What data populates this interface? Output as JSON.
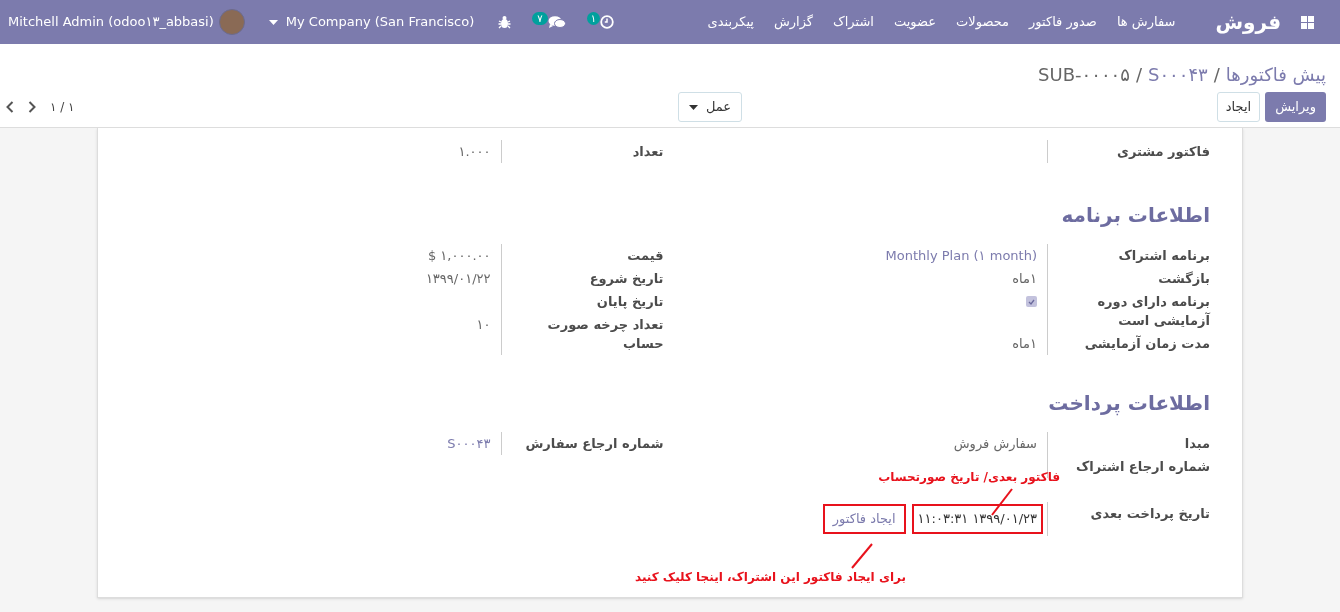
{
  "navbar": {
    "app_title": "فروش",
    "menu": [
      "سفارش ها",
      "صدور فاکتور",
      "محصولات",
      "عضویت",
      "اشتراک",
      "گزارش",
      "پیکربندی"
    ],
    "activity_count": "۱",
    "message_count": "۷",
    "company": "My Company (San Francisco)",
    "user": "Mitchell Admin (odoo۱۳_abbasi)"
  },
  "breadcrumb": [
    {
      "label": "پیش فاکتورها",
      "link": true
    },
    {
      "separator": "/",
      "label": "S۰۰۰۴۳",
      "link": true
    },
    {
      "separator": "/",
      "label": "SUB-۰۰۰۰۵",
      "link": false
    }
  ],
  "buttons": {
    "edit": "ویرایش",
    "create": "ایجاد",
    "action": "عمل"
  },
  "pager": "۱ / ۱",
  "sections": [
    {
      "right": [
        {
          "label": "فاکتور مشتری",
          "kind": "text"
        }
      ],
      "left": [
        {
          "label": "تعداد",
          "kind": "text",
          "value": "۱.۰۰۰"
        }
      ]
    },
    {
      "title": "اطلاعات برنامه",
      "right": [
        {
          "label": "برنامه اشتراک",
          "kind": "link",
          "value": "Monthly Plan (۱ month)"
        },
        {
          "label": "بازگشت",
          "kind": "text",
          "value": "۱ماه"
        },
        {
          "label": "برنامه دارای دوره آزمایشی است",
          "kind": "checkbox",
          "checked": true
        },
        {
          "label": "مدت زمان آزمایشی",
          "kind": "text",
          "value": "۱ماه"
        }
      ],
      "left": [
        {
          "label": "قیمت",
          "kind": "text",
          "value": "۱,۰۰۰.۰۰ $"
        },
        {
          "label": "تاریخ شروع",
          "kind": "text",
          "value": "۱۳۹۹/۰۱/۲۲"
        },
        {
          "label": "تاریخ پایان",
          "kind": "text"
        },
        {
          "label": "تعداد چرخه صورت حساب",
          "kind": "text",
          "value": "۱۰"
        }
      ]
    },
    {
      "title": "اطلاعات پرداخت",
      "right": [
        {
          "label": "مبدا",
          "kind": "text",
          "value": "سفارش فروش"
        },
        {
          "label": "شماره ارجاع اشتراک",
          "kind": "text"
        },
        {
          "label": "تاریخ پرداخت بعدی",
          "kind": "date_action",
          "value": "۱۳۹۹/۰۱/۲۳ ۱۱:۰۳:۳۱",
          "action": "ایجاد فاکتور",
          "highlighted": true
        }
      ],
      "left": [
        {
          "label": "شماره ارجاع سفارش",
          "kind": "link",
          "value": "S۰۰۰۴۳"
        }
      ]
    }
  ],
  "annotations": [
    {
      "text": "فاکتور بعدی/ تاریخ صورتحساب",
      "kind": "date_note"
    },
    {
      "text": "برای ایجاد فاکتور این اشتراک، اینجا کلیک کنید",
      "kind": "button_note"
    }
  ]
}
